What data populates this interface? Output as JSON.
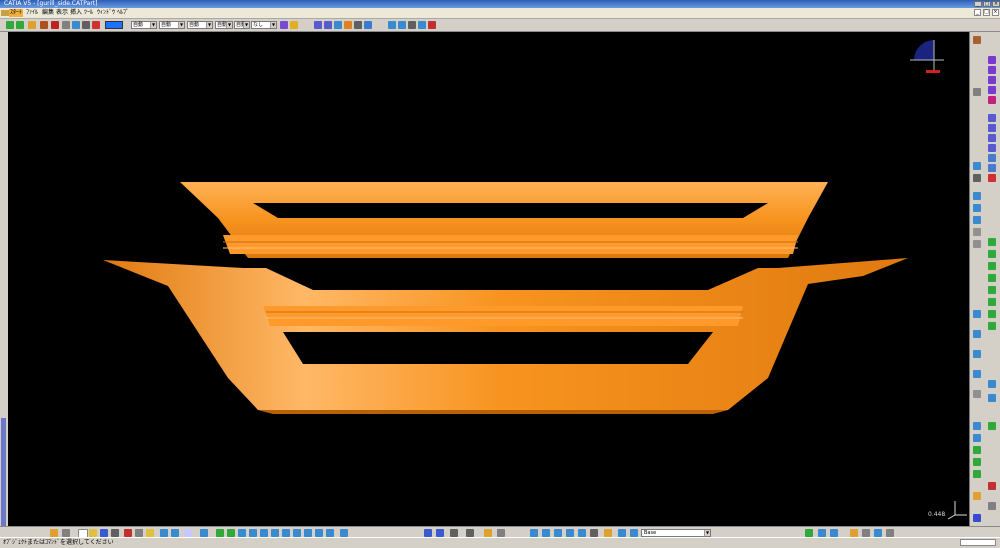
{
  "window": {
    "title": "CATIA V5 - [gurill_side.CATPart]",
    "controls": [
      "_",
      "□",
      "×"
    ]
  },
  "menu": {
    "items": [
      "ｽﾀｰﾄ",
      "ﾌｧｲﾙ",
      "編集",
      "表示",
      "挿入",
      "ﾂｰﾙ",
      "ｳｨﾝﾄﾞｳ",
      "ﾍﾙﾌﾟ"
    ],
    "active_index": 0,
    "mdi_controls": [
      "_",
      "□",
      "×"
    ]
  },
  "toolbar": {
    "color_swatch": "#1e72ff",
    "combos": [
      {
        "value": "自動"
      },
      {
        "value": "自動"
      },
      {
        "value": "自動"
      },
      {
        "value": "自動"
      },
      {
        "value": "自動"
      },
      {
        "value": "なし"
      }
    ]
  },
  "viewport": {
    "background": "#000000",
    "part_color": "#f7931e",
    "scale_value": "0.448"
  },
  "bottom_toolbar": {
    "layer_combo": "Base"
  },
  "status": {
    "message": "ｵﾌﾞｼﾞｪｸﾄまたはｺﾏﾝﾄﾞを選択してください"
  },
  "colors": {
    "chrome": "#d4d0c8",
    "title_start": "#2b5fb8",
    "title_end": "#6d9be0",
    "accent": "#f0b040"
  }
}
